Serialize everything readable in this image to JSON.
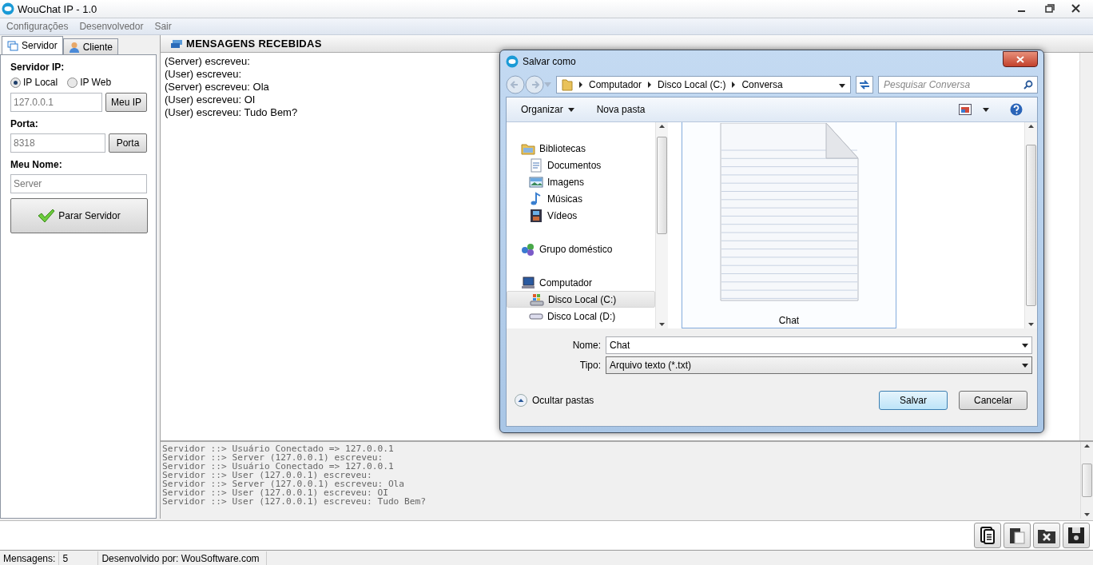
{
  "window": {
    "title": "WouChat IP - 1.0"
  },
  "menu": [
    "Configurações",
    "Desenvolvedor",
    "Sair"
  ],
  "tabs": [
    {
      "label": "Servidor",
      "selected": true
    },
    {
      "label": "Cliente",
      "selected": false
    }
  ],
  "server_form": {
    "ip_label": "Servidor IP:",
    "ip_options": [
      {
        "label": "IP Local",
        "selected": true
      },
      {
        "label": "IP Web",
        "selected": false
      }
    ],
    "ip_value": "127.0.0.1",
    "ip_button": "Meu IP",
    "port_label": "Porta:",
    "port_value": "8318",
    "port_button": "Porta",
    "name_label": "Meu Nome:",
    "name_value": "Server",
    "action_button": "Parar Servidor"
  },
  "messages": {
    "title": "MENSAGENS RECEBIDAS",
    "lines": [
      "(Server) escreveu:",
      "(User) escreveu:",
      "(Server) escreveu: Ola",
      "(User) escreveu: OI",
      "(User) escreveu: Tudo Bem?"
    ]
  },
  "log": [
    "Servidor ::> Usuário Conectado => 127.0.0.1",
    "Servidor ::> Server (127.0.0.1) escreveu:",
    "Servidor ::> Usuário Conectado => 127.0.0.1",
    "Servidor ::> User (127.0.0.1) escreveu:",
    "Servidor ::> Server (127.0.0.1) escreveu: Ola",
    "Servidor ::> User (127.0.0.1) escreveu: OI",
    "Servidor ::> User (127.0.0.1) escreveu: Tudo Bem?"
  ],
  "status_bar": {
    "count_label": "Mensagens:",
    "count": "5",
    "credit": "Desenvolvido por: WouSoftware.com"
  },
  "dialog": {
    "title": "Salvar como",
    "breadcrumb": [
      "Computador",
      "Disco Local (C:)",
      "Conversa"
    ],
    "search": {
      "placeholder": "Pesquisar Conversa"
    },
    "toolbar": [
      "Organizar",
      "Nova pasta"
    ],
    "nav": [
      {
        "label": "Bibliotecas",
        "kind": "library",
        "selected": false,
        "children": [
          {
            "label": "Documentos",
            "kind": "documents",
            "selected": false
          },
          {
            "label": "Imagens",
            "kind": "pictures",
            "selected": false
          },
          {
            "label": "Músicas",
            "kind": "music",
            "selected": false
          },
          {
            "label": "Vídeos",
            "kind": "videos",
            "selected": false
          }
        ]
      },
      {
        "label": "Grupo doméstico",
        "kind": "homegroup",
        "selected": false
      },
      {
        "label": "Computador",
        "kind": "computer",
        "selected": false,
        "children": [
          {
            "label": "Disco Local (C:)",
            "kind": "system-drive",
            "selected": true
          },
          {
            "label": "Disco Local (D:)",
            "kind": "drive",
            "selected": false
          }
        ]
      }
    ],
    "files": [
      {
        "name": "Chat"
      }
    ],
    "name_label": "Nome:",
    "name_value": "Chat",
    "type_label": "Tipo:",
    "type_value": "Arquivo texto (*.txt)",
    "hide_folders": "Ocultar pastas",
    "buttons": [
      {
        "label": "Salvar",
        "kind": "default"
      },
      {
        "label": "Cancelar",
        "kind": "normal"
      }
    ]
  }
}
